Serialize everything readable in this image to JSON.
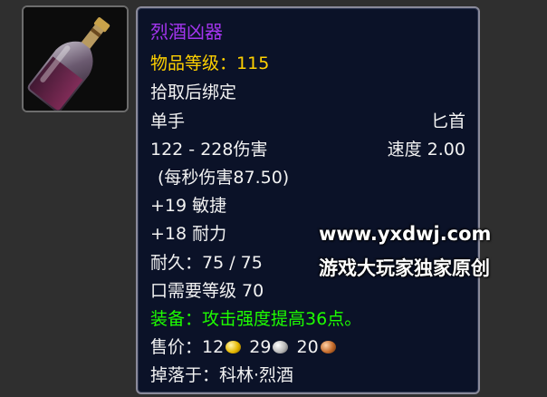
{
  "item": {
    "name": "烈酒凶器",
    "item_level_label": "物品等级：",
    "item_level_value": "115",
    "binding": "拾取后绑定",
    "slot": "单手",
    "weapon_type": "匕首",
    "damage": "122 - 228伤害",
    "speed": "速度 2.00",
    "dps": "(每秒伤害87.50)",
    "stat_agility": "+19 敏捷",
    "stat_stamina": "+18 耐力",
    "durability": "耐久：75 / 75",
    "required_level": "口需要等级 70",
    "equip_label": "装备：",
    "equip_effect": "攻击强度提高36点。",
    "sell_label": "售价：",
    "sell_gold": "12",
    "sell_silver": "29",
    "sell_copper": "20",
    "drops_from": "掉落于：科林·烈酒",
    "icon": "bottle-icon"
  },
  "watermark": {
    "url": "www.yxdwj.com",
    "slogan": "游戏大玩家独家原创"
  },
  "colors": {
    "epic_purple": "#a335ee",
    "item_level_gold": "#ffd100",
    "equip_green": "#1eff00",
    "tooltip_bg": "#0b1228"
  }
}
